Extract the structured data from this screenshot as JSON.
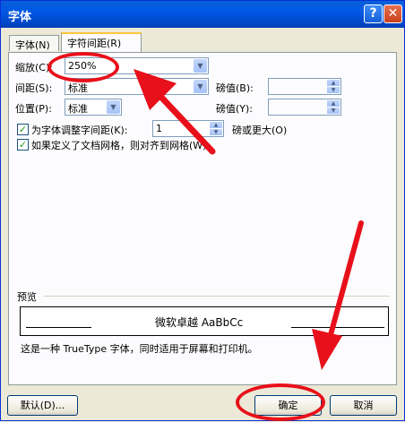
{
  "window": {
    "title": "字体",
    "help_glyph": "?",
    "close_glyph": "✕"
  },
  "tabs": [
    {
      "label": "字体(N)"
    },
    {
      "label": "字符间距(R)"
    }
  ],
  "scale": {
    "label": "缩放(C):",
    "value": "250%"
  },
  "spacing": {
    "label": "间距(S):",
    "value": "标准",
    "pt_label": "磅值(B):",
    "pt_value": ""
  },
  "position": {
    "label": "位置(P):",
    "value": "标准",
    "pt_label": "磅值(Y):",
    "pt_value": ""
  },
  "kerning": {
    "label": "为字体调整字间距(K):",
    "checked": true,
    "value": "1",
    "suffix": "磅或更大(O)"
  },
  "snap_grid": {
    "label": "如果定义了文档网格，则对齐到网格(W)",
    "checked": true
  },
  "preview": {
    "label": "预览",
    "sample": "微软卓越  AaBbCc",
    "description": "这是一种 TrueType 字体，同时适用于屏幕和打印机。"
  },
  "buttons": {
    "default": "默认(D)...",
    "ok": "确定",
    "cancel": "取消"
  },
  "annotation_color": "#e8101a"
}
